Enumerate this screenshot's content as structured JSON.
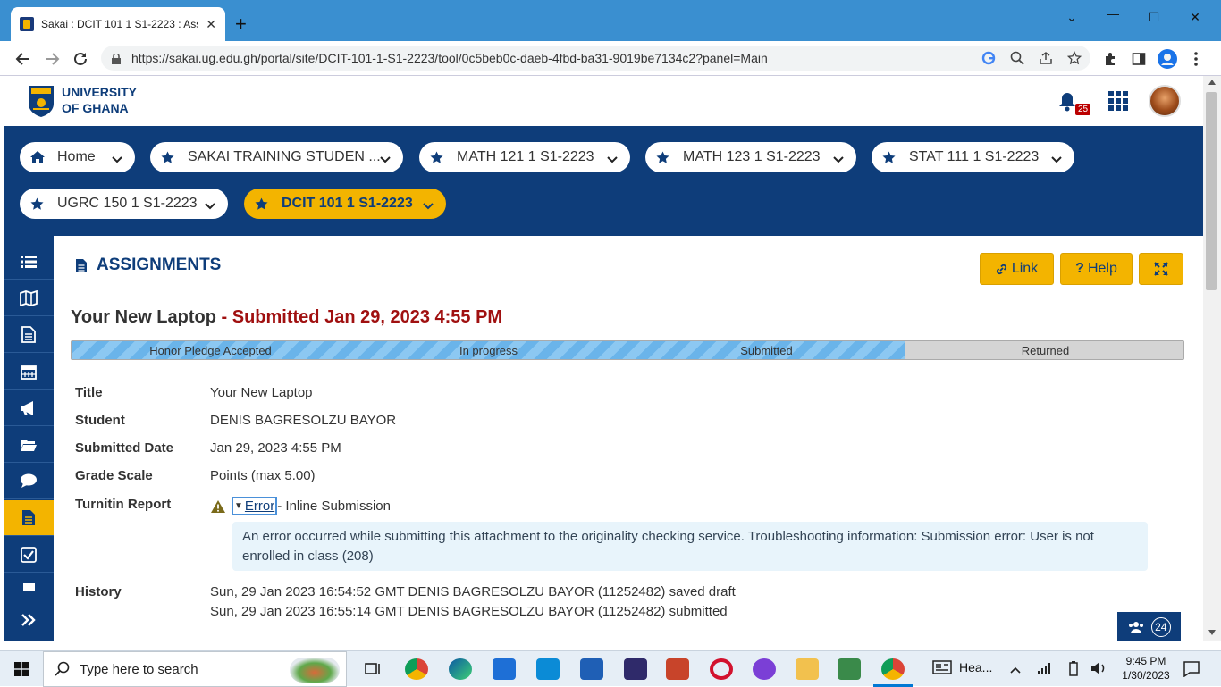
{
  "browser": {
    "tab_title": "Sakai : DCIT 101 1 S1-2223 : Assignments",
    "url": "https://sakai.ug.edu.gh/portal/site/DCIT-101-1-S1-2223/tool/0c5beb0c-daeb-4fbd-ba31-9019be7134c2?panel=Main"
  },
  "header": {
    "university_line1": "UNIVERSITY",
    "university_line2": "OF GHANA",
    "notification_count": "25"
  },
  "sites": [
    {
      "label": "Home",
      "icon": "home-icon",
      "active": false
    },
    {
      "label": "SAKAI TRAINING STUDEN ...",
      "icon": "star-icon",
      "active": false
    },
    {
      "label": "MATH 121 1 S1-2223",
      "icon": "star-icon",
      "active": false
    },
    {
      "label": "MATH 123 1 S1-2223",
      "icon": "star-icon",
      "active": false
    },
    {
      "label": "STAT 111 1 S1-2223",
      "icon": "star-icon",
      "active": false
    },
    {
      "label": "UGRC 150 1 S1-2223",
      "icon": "star-icon",
      "active": false
    },
    {
      "label": "DCIT 101 1 S1-2223",
      "icon": "star-icon",
      "active": true
    }
  ],
  "tool": {
    "title": "ASSIGNMENTS",
    "link_label": "Link",
    "help_label": "Help"
  },
  "assignment": {
    "name": "Your New Laptop",
    "status": " - Submitted Jan 29, 2023 4:55 PM",
    "progress_steps": [
      "Honor Pledge Accepted",
      "In progress",
      "Submitted",
      "Returned"
    ],
    "completed_steps": 3,
    "fields": {
      "title_label": "Title",
      "title_value": "Your New Laptop",
      "student_label": "Student",
      "student_value": "DENIS BAGRESOLZU BAYOR",
      "submitted_label": "Submitted Date",
      "submitted_value": "Jan 29, 2023 4:55 PM",
      "grade_label": "Grade Scale",
      "grade_value": "Points (max 5.00)",
      "turnitin_label": "Turnitin Report",
      "turnitin_error": "Error",
      "turnitin_suffix": " - Inline Submission",
      "error_message": "An error occurred while submitting this attachment to the originality checking service. Troubleshooting information: Submission error: User is not enrolled in class (208)",
      "history_label": "History",
      "history": [
        "Sun, 29 Jan 2023 16:54:52 GMT DENIS BAGRESOLZU BAYOR (11252482) saved draft",
        "Sun, 29 Jan 2023 16:55:14 GMT DENIS BAGRESOLZU BAYOR (11252482) submitted"
      ]
    }
  },
  "presence_count": "24",
  "taskbar": {
    "search_placeholder": "Type here to search",
    "headlines": "Hea...",
    "time": "9:45 PM",
    "date": "1/30/2023"
  },
  "colors": {
    "brand_blue": "#0e3d7a",
    "brand_gold": "#f3b400",
    "error_red": "#a01010"
  }
}
